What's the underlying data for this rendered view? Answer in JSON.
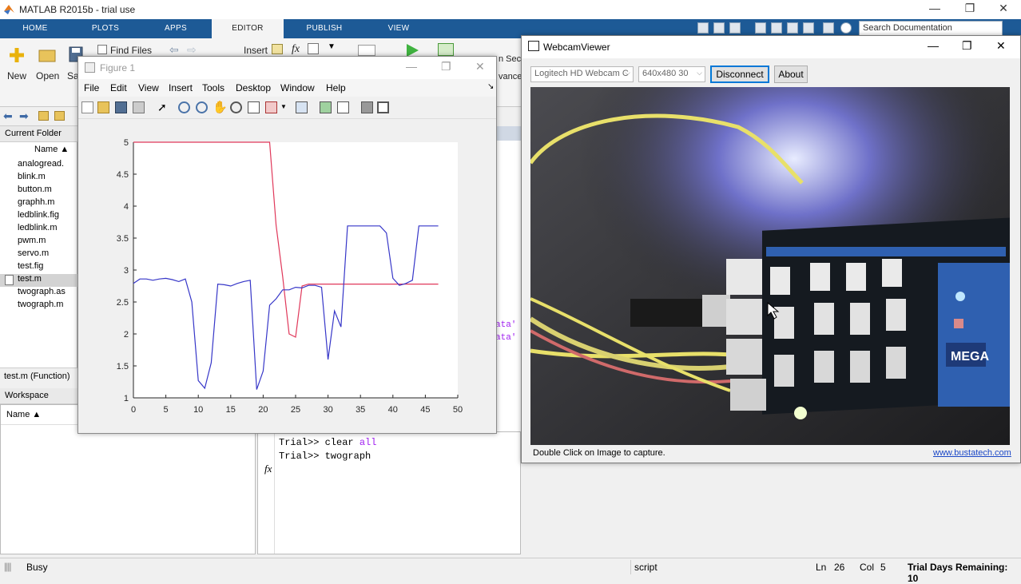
{
  "app": {
    "title": "MATLAB R2015b - trial use"
  },
  "window_controls": {
    "minimize": "—",
    "maximize": "❐",
    "close": "✕"
  },
  "tabs": [
    {
      "label": "HOME"
    },
    {
      "label": "PLOTS"
    },
    {
      "label": "APPS"
    },
    {
      "label": "EDITOR"
    },
    {
      "label": "PUBLISH"
    },
    {
      "label": "VIEW"
    }
  ],
  "search": {
    "placeholder": "Search Documentation"
  },
  "ribbon": {
    "new_label": "New",
    "open_label": "Open",
    "save_label": "Sa",
    "find_files_label": "Find Files",
    "insert_label": "Insert",
    "fx_label": "fx",
    "run_section_label": "n Sec",
    "advance_label": "vance"
  },
  "current_folder": {
    "title": "Current Folder",
    "name_header": "Name ▲",
    "files": [
      {
        "name": "analogread.",
        "selected": false
      },
      {
        "name": "blink.m",
        "selected": false
      },
      {
        "name": "button.m",
        "selected": false
      },
      {
        "name": "graphh.m",
        "selected": false
      },
      {
        "name": "ledblink.fig",
        "selected": false
      },
      {
        "name": "ledblink.m",
        "selected": false
      },
      {
        "name": "pwm.m",
        "selected": false
      },
      {
        "name": "servo.m",
        "selected": false
      },
      {
        "name": "test.fig",
        "selected": false
      },
      {
        "name": "test.m",
        "selected": true
      },
      {
        "name": "twograph.as",
        "selected": false
      },
      {
        "name": "twograph.m",
        "selected": false
      }
    ],
    "detail": "test.m  (Function)"
  },
  "workspace": {
    "title": "Workspace",
    "name_header": "Name ▲"
  },
  "editor": {
    "frag1": "ata'",
    "frag2": "ata'"
  },
  "command_window": {
    "lines": [
      {
        "prompt": "Trial>> ",
        "cmd": "clear ",
        "kw": "all"
      },
      {
        "prompt": "Trial>> ",
        "cmd": "twograph",
        "kw": ""
      }
    ],
    "fx": "fx"
  },
  "status": {
    "state": "Busy",
    "script": "script",
    "ln_label": "Ln",
    "ln": "26",
    "col_label": "Col",
    "col": "5",
    "trial": "Trial Days Remaining: 10"
  },
  "figure": {
    "title": "Figure 1",
    "menu": [
      "File",
      "Edit",
      "View",
      "Insert",
      "Tools",
      "Desktop",
      "Window",
      "Help"
    ]
  },
  "webcam": {
    "title": "WebcamViewer",
    "camera": "Logitech HD Webcam C",
    "resolution": "640x480 30",
    "disconnect_label": "Disconnect",
    "about_label": "About",
    "hint": "Double Click on Image to capture.",
    "link": "www.bustatech.com",
    "board_label": "MEGA"
  },
  "chart_data": {
    "type": "line",
    "title": "",
    "xlabel": "",
    "ylabel": "",
    "xlim": [
      0,
      50
    ],
    "ylim": [
      1,
      5
    ],
    "xticks": [
      0,
      5,
      10,
      15,
      20,
      25,
      30,
      35,
      40,
      45,
      50
    ],
    "yticks": [
      1,
      1.5,
      2,
      2.5,
      3,
      3.5,
      4,
      4.5,
      5
    ],
    "series": [
      {
        "color": "#e0385a",
        "x": [
          0,
          21,
          22,
          23,
          24,
          25,
          26,
          27,
          28,
          29,
          30,
          35,
          40,
          45,
          47
        ],
        "y": [
          5,
          5,
          3.7,
          2.9,
          2.0,
          1.95,
          2.75,
          2.78,
          2.78,
          2.78,
          2.78,
          2.78,
          2.78,
          2.78,
          2.78
        ]
      },
      {
        "color": "#3636c8",
        "x": [
          0,
          1,
          2,
          3,
          4,
          5,
          6,
          7,
          8,
          9,
          10,
          11,
          12,
          13,
          14,
          15,
          16,
          17,
          18,
          19,
          20,
          21,
          22,
          23,
          24,
          25,
          26,
          27,
          28,
          29,
          30,
          31,
          32,
          33,
          34,
          35,
          36,
          37,
          38,
          39,
          40,
          41,
          42,
          43,
          44,
          45,
          46,
          47
        ],
        "y": [
          2.79,
          2.86,
          2.86,
          2.84,
          2.86,
          2.87,
          2.85,
          2.82,
          2.86,
          2.5,
          1.27,
          1.15,
          1.55,
          2.78,
          2.77,
          2.75,
          2.79,
          2.82,
          2.84,
          1.13,
          1.42,
          2.45,
          2.55,
          2.69,
          2.69,
          2.73,
          2.72,
          2.76,
          2.76,
          2.73,
          1.6,
          2.36,
          2.11,
          3.69,
          3.69,
          3.69,
          3.69,
          3.69,
          3.69,
          3.58,
          2.87,
          2.76,
          2.79,
          2.84,
          3.69,
          3.69,
          3.69,
          3.69
        ]
      }
    ]
  }
}
